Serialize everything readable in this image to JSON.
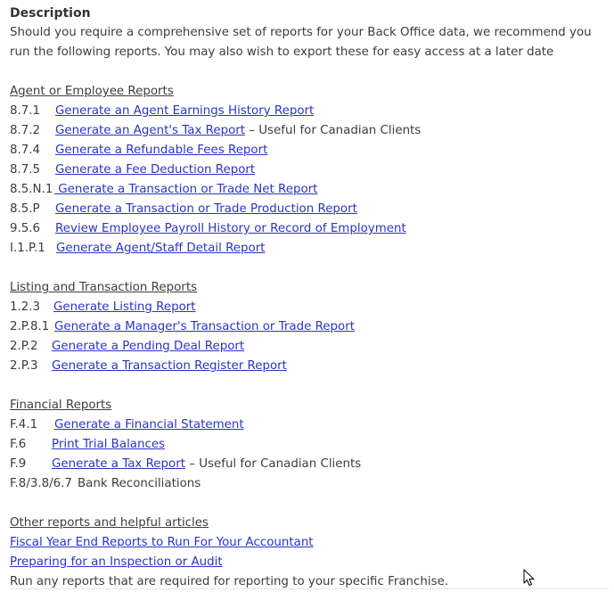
{
  "heading": "Description",
  "intro": "Should you require a comprehensive set of reports for your Back Office data, we recommend you run the following reports.   You may also wish to export these for easy access at a later date",
  "agent_section": {
    "title": "Agent or Employee Reports",
    "rows": [
      {
        "code": "8.7.1",
        "link": "Generate an Agent Earnings History Report",
        "note": ""
      },
      {
        "code": "8.7.2",
        "link": "Generate an Agent's Tax Report",
        "note": " – Useful for Canadian Clients"
      },
      {
        "code": "8.7.4",
        "link": "Generate a Refundable Fees Report",
        "note": ""
      },
      {
        "code": "8.7.5",
        "link": "Generate a Fee Deduction Report",
        "note": ""
      },
      {
        "code": "8.5.N.1",
        "link": " Generate a Transaction or Trade Net Report",
        "note": ""
      },
      {
        "code": "8.5.P",
        "link": "Generate a Transaction or Trade Production Report",
        "note": ""
      },
      {
        "code": "9.5.6",
        "link": "Review Employee Payroll History or Record of Employment",
        "note": ""
      },
      {
        "code": "I.1.P.1",
        "link": "Generate Agent/Staff Detail Report",
        "note": ""
      }
    ]
  },
  "listing_section": {
    "title": "Listing and Transaction Reports",
    "rows": [
      {
        "code": "1.2.3",
        "link": "Generate Listing Report",
        "note": ""
      },
      {
        "code": "2.P.8.1",
        "link": "Generate a Manager's Transaction or Trade Report",
        "note": ""
      },
      {
        "code": "2.P.2",
        "link": "Generate a Pending Deal Report",
        "note": ""
      },
      {
        "code": "2.P.3",
        "link": "Generate a Transaction Register Report",
        "note": ""
      }
    ]
  },
  "financial_section": {
    "title": "Financial Reports",
    "rows": [
      {
        "code": "F.4.1",
        "link": "Generate a Financial Statement",
        "note": ""
      },
      {
        "code": "F.6",
        "link": "Print Trial Balances",
        "note": ""
      },
      {
        "code": "F.9",
        "link": "Generate a Tax Report",
        "note": " – Useful for Canadian Clients"
      }
    ],
    "plain_row": {
      "code": "F.8/3.8/6.7",
      "text": "Bank Reconciliations"
    }
  },
  "other_section": {
    "title": "Other reports and helpful articles",
    "links": [
      "Fiscal Year End Reports to Run For Your Accountant",
      "Preparing for an Inspection or Audit"
    ],
    "closing": "Run any reports that are required for reporting to your specific Franchise."
  }
}
